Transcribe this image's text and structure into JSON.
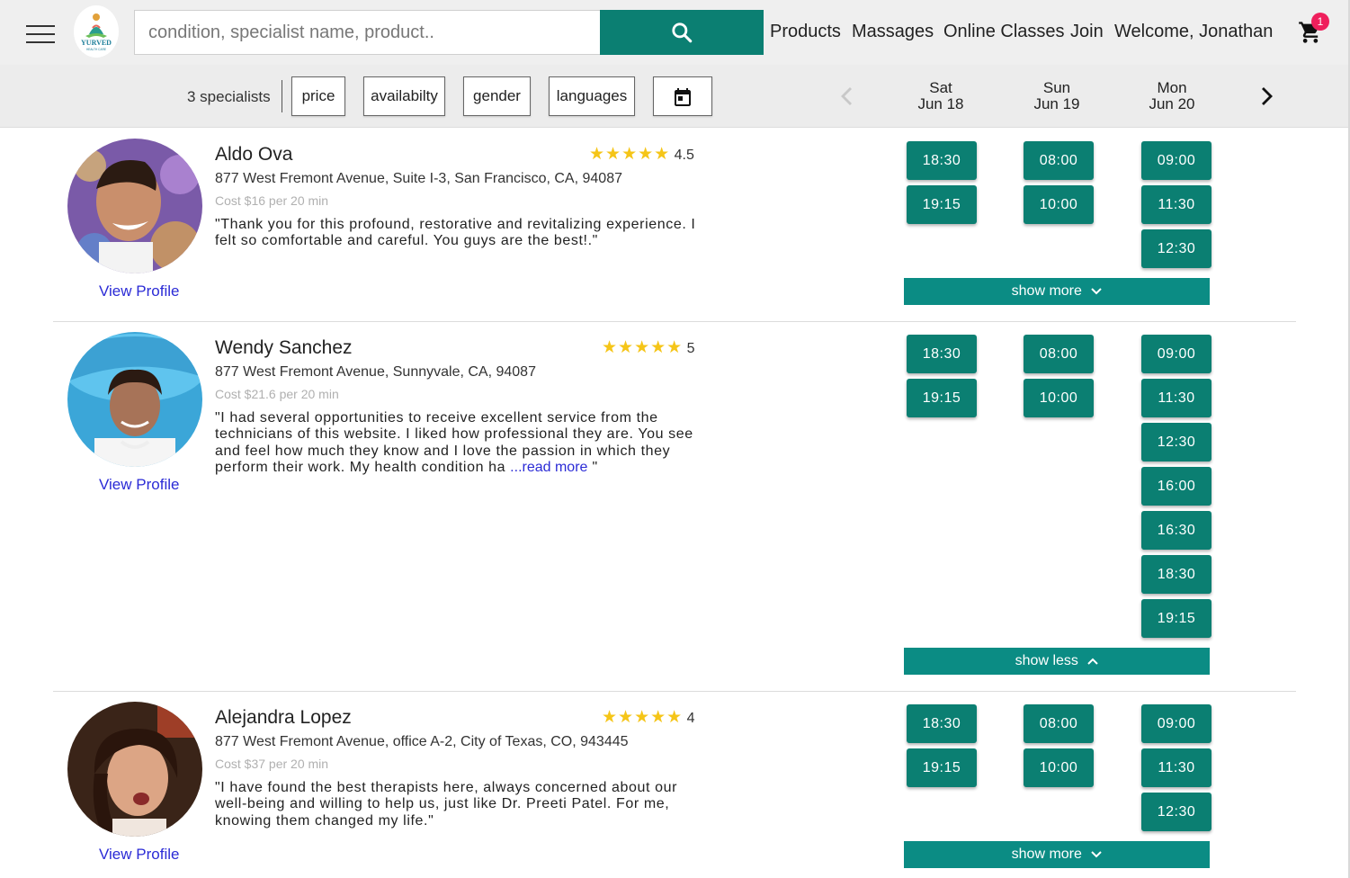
{
  "header": {
    "search_placeholder": "condition, specialist name, product..",
    "nav": [
      "Products",
      "Massages",
      "Online Classes",
      "Join",
      "Welcome, Jonathan"
    ],
    "cart_count": "1",
    "brand_accent": "#0b7f72"
  },
  "filters": {
    "count": "3 specialists",
    "buttons": [
      "price",
      "availabilty",
      "gender",
      "languages"
    ],
    "days": [
      {
        "weekday": "Sat",
        "date": "Jun 18"
      },
      {
        "weekday": "Sun",
        "date": "Jun 19"
      },
      {
        "weekday": "Mon",
        "date": "Jun 20"
      }
    ]
  },
  "specialists": [
    {
      "name": "Aldo Ova",
      "stars": "★★★★★",
      "rating": "4.5",
      "address": "877 West Fremont Avenue, Suite I-3, San Francisco, CA, 94087",
      "cost": "Cost $16 per 20 min",
      "review": "\"Thank you for this profound, restorative and revitalizing experience. I felt so comfortable and careful. You guys are the best!.\"",
      "view_profile": "View Profile",
      "slots": {
        "sat": [
          "18:30",
          "19:15"
        ],
        "sun": [
          "08:00",
          "10:00"
        ],
        "mon": [
          "09:00",
          "11:30",
          "12:30"
        ]
      },
      "toggle": "show more"
    },
    {
      "name": "Wendy Sanchez",
      "stars": "★★★★★",
      "rating": "5",
      "address": "877 West Fremont Avenue, Sunnyvale, CA, 94087",
      "cost": "Cost $21.6 per 20 min",
      "review": "\"I had several opportunities to receive excellent service from the technicians of this website. I liked how professional they are. You see and feel how much they know and I love the passion in which they perform their work. My health condition ha ",
      "read_more": "...read more",
      "review_end": " \"",
      "view_profile": "View Profile",
      "slots": {
        "sat": [
          "18:30",
          "19:15"
        ],
        "sun": [
          "08:00",
          "10:00"
        ],
        "mon": [
          "09:00",
          "11:30",
          "12:30",
          "16:00",
          "16:30",
          "18:30",
          "19:15"
        ]
      },
      "toggle": "show less"
    },
    {
      "name": "Alejandra Lopez",
      "stars": "★★★★★",
      "rating": "4",
      "address": "877 West Fremont Avenue, office A-2, City of Texas, CO, 943445",
      "cost": "Cost $37 per 20 min",
      "review": "\"I have found the best therapists here, always concerned about our well-being and willing to help us, just like Dr. Preeti Patel. For me, knowing them changed my life.\"",
      "view_profile": "View Profile",
      "slots": {
        "sat": [
          "18:30",
          "19:15"
        ],
        "sun": [
          "08:00",
          "10:00"
        ],
        "mon": [
          "09:00",
          "11:30",
          "12:30"
        ]
      },
      "toggle": "show more"
    }
  ]
}
